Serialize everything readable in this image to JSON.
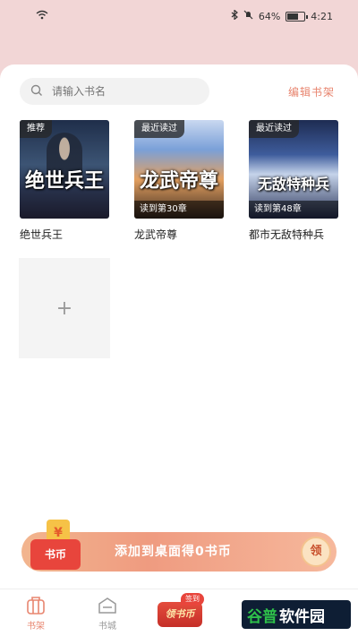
{
  "status_bar": {
    "battery": "64%",
    "time": "4:21",
    "battery_level": 0.64
  },
  "search": {
    "placeholder": "请输入书名",
    "icon": "search-icon"
  },
  "header": {
    "edit_label": "编辑书架"
  },
  "books": [
    {
      "title": "绝世兵王",
      "tag": "推荐",
      "cover_text": "绝世兵王",
      "progress": ""
    },
    {
      "title": "龙武帝尊",
      "tag": "最近读过",
      "cover_text": "龙武帝尊",
      "progress": "读到第30章"
    },
    {
      "title": "都市无敌特种兵",
      "tag": "最近读过",
      "cover_text": "无敌特种兵",
      "progress": "读到第48章"
    }
  ],
  "add_book": {
    "label": "+"
  },
  "promo": {
    "coin_glyph": "¥",
    "badge_label": "书币",
    "text": "添加到桌面得0书币",
    "claim_label": "领"
  },
  "tabbar": {
    "shelf_label": "书架",
    "store_label": "书城",
    "coins_label": "领书币",
    "coins_flag": "签到"
  },
  "watermark": {
    "part_a": "谷普",
    "part_b": "软件园"
  },
  "colors": {
    "accent": "#e8856f",
    "header_bg": "#f2d6d6",
    "promo_start": "#f2b58e",
    "tab_red": "#e44d3d"
  }
}
